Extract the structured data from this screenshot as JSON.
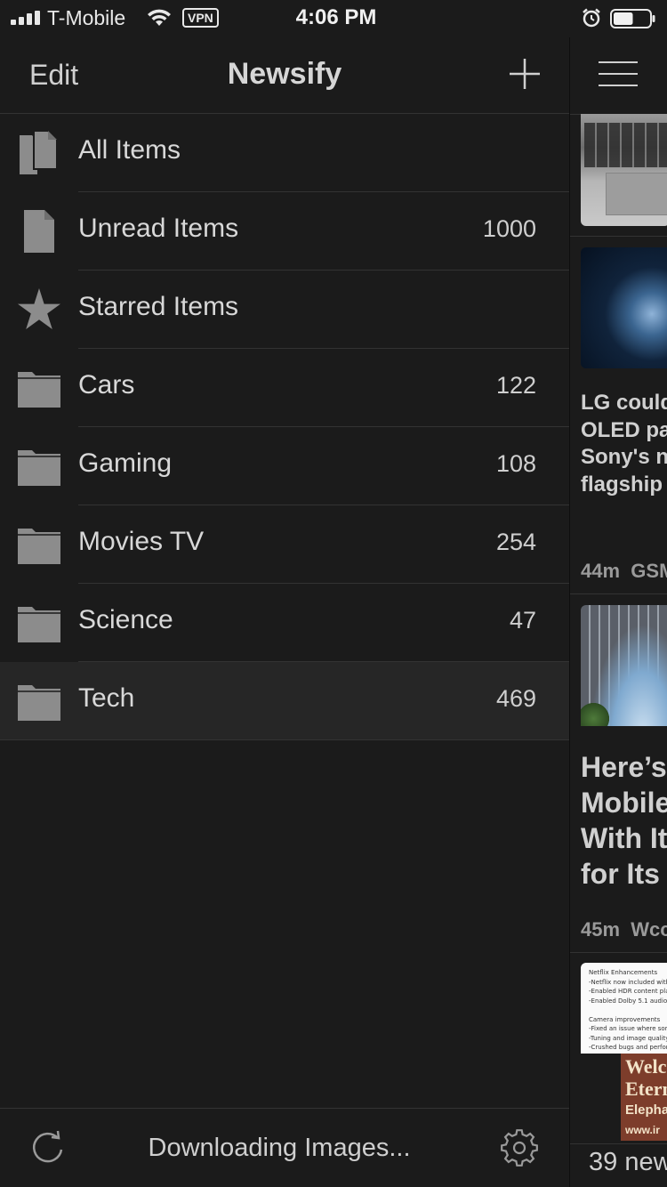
{
  "status_bar": {
    "carrier": "T-Mobile",
    "vpn": "VPN",
    "time": "4:06 PM",
    "icons": [
      "signal-icon",
      "wifi-icon",
      "alarm-icon",
      "battery-icon"
    ],
    "battery_level": 0.55
  },
  "nav": {
    "edit_label": "Edit",
    "title": "Newsify",
    "add_icon": "plus-icon"
  },
  "menu": {
    "items": [
      {
        "label": "All Items",
        "count": "",
        "icon": "all-items-icon"
      },
      {
        "label": "Unread Items",
        "count": "1000",
        "icon": "document-icon"
      },
      {
        "label": "Starred Items",
        "count": "",
        "icon": "star-icon"
      },
      {
        "label": "Cars",
        "count": "122",
        "icon": "folder-icon"
      },
      {
        "label": "Gaming",
        "count": "108",
        "icon": "folder-icon"
      },
      {
        "label": "Movies  TV",
        "count": "254",
        "icon": "folder-icon"
      },
      {
        "label": "Science",
        "count": "47",
        "icon": "folder-icon"
      },
      {
        "label": "Tech",
        "count": "469",
        "icon": "folder-icon",
        "selected": true
      }
    ]
  },
  "bottom_bar": {
    "status": "Downloading Images...",
    "refresh_icon": "refresh-icon",
    "settings_icon": "settings-gear-icon"
  },
  "peek": {
    "menu_icon": "hamburger-menu-icon",
    "article1": {
      "title_lines": [
        "LG could",
        "OLED pa",
        "Sony's n",
        "flagship"
      ],
      "age": "44m",
      "source": "GSM"
    },
    "article2": {
      "title_lines": [
        "Here’s",
        "Mobile",
        "With It",
        "for Its"
      ],
      "age": "45m",
      "source": "Wcc"
    },
    "article3": {
      "doc_text": "Netflix Enhancements\n-Netflix now included with\n-Enabled HDR content pla\n-Enabled Dolby 5.1 audio p\n\nCamera improvements\n-Fixed an issue where som\n-Tuning and image quality\n-Crushed bugs and perfor",
      "promo_line1": "Welc",
      "promo_line2": "Etern",
      "promo_line3": "Elepha",
      "promo_line4": "www.ir"
    },
    "new_count": "39 new"
  },
  "colors": {
    "background": "#1b1b1b",
    "selected_row": "#262626",
    "separator": "#333333",
    "text": "#d8d8d8",
    "icon": "#8c8c8c"
  }
}
